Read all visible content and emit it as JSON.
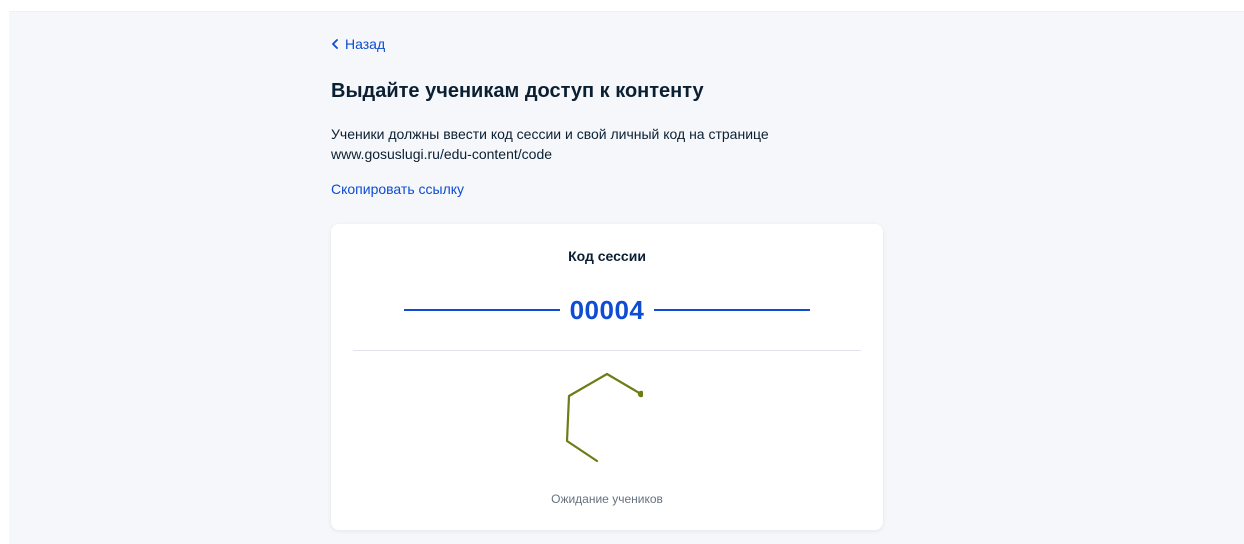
{
  "nav": {
    "back_label": "Назад"
  },
  "page": {
    "title": "Выдайте ученикам доступ к контенту",
    "description_line1": "Ученики должны ввести код сессии и свой личный код на странице",
    "description_line2": "www.gosuslugi.ru/edu-content/code",
    "copy_link_label": "Скопировать ссылку"
  },
  "session": {
    "title": "Код сессии",
    "code": "00004",
    "status": "Ожидание учеников"
  },
  "colors": {
    "accent": "#0d4cd3",
    "spinner": "#6b7d13",
    "background": "#f5f7fa",
    "text": "#0b1f33",
    "muted": "#66727f"
  },
  "icons": {
    "back": "chevron-left-icon",
    "loader": "hexagon-loader-icon"
  }
}
